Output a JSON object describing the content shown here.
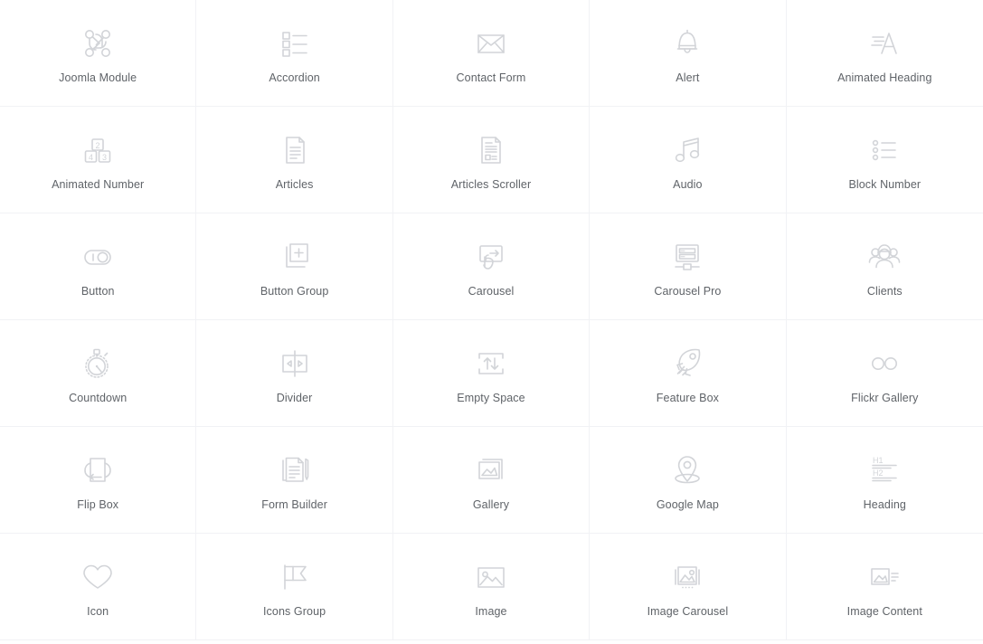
{
  "grid": {
    "columns": 5,
    "rows": 6,
    "accent_color": "#d2d4d8",
    "label_color": "#5f6368",
    "divider_color": "#f1f2f5",
    "background_color": "#ffffff"
  },
  "elements": [
    {
      "label": "Joomla Module",
      "icon": "joomla-module-icon"
    },
    {
      "label": "Accordion",
      "icon": "accordion-icon"
    },
    {
      "label": "Contact Form",
      "icon": "envelope-icon"
    },
    {
      "label": "Alert",
      "icon": "bell-icon"
    },
    {
      "label": "Animated Heading",
      "icon": "animated-heading-icon"
    },
    {
      "label": "Animated Number",
      "icon": "number-blocks-icon"
    },
    {
      "label": "Articles",
      "icon": "document-lines-icon"
    },
    {
      "label": "Articles Scroller",
      "icon": "document-columns-icon"
    },
    {
      "label": "Audio",
      "icon": "music-note-icon"
    },
    {
      "label": "Block Number",
      "icon": "bullet-list-icon"
    },
    {
      "label": "Button",
      "icon": "toggle-switch-icon"
    },
    {
      "label": "Button Group",
      "icon": "plus-square-stack-icon"
    },
    {
      "label": "Carousel",
      "icon": "swipe-hand-icon"
    },
    {
      "label": "Carousel Pro",
      "icon": "slider-panel-icon"
    },
    {
      "label": "Clients",
      "icon": "people-group-icon"
    },
    {
      "label": "Countdown",
      "icon": "stopwatch-icon"
    },
    {
      "label": "Divider",
      "icon": "split-arrows-icon"
    },
    {
      "label": "Empty Space",
      "icon": "up-down-arrows-icon"
    },
    {
      "label": "Feature Box",
      "icon": "rocket-icon"
    },
    {
      "label": "Flickr Gallery",
      "icon": "two-circles-icon"
    },
    {
      "label": "Flip Box",
      "icon": "flip-card-icon"
    },
    {
      "label": "Form Builder",
      "icon": "document-pen-icon"
    },
    {
      "label": "Gallery",
      "icon": "photo-stack-icon"
    },
    {
      "label": "Google Map",
      "icon": "map-pin-icon"
    },
    {
      "label": "Heading",
      "icon": "heading-levels-icon"
    },
    {
      "label": "Icon",
      "icon": "heart-icon"
    },
    {
      "label": "Icons Group",
      "icon": "flag-icon"
    },
    {
      "label": "Image",
      "icon": "picture-icon"
    },
    {
      "label": "Image Carousel",
      "icon": "picture-carousel-icon"
    },
    {
      "label": "Image Content",
      "icon": "picture-text-icon"
    }
  ],
  "icon_glyph_text": {
    "heading_h1": "H1",
    "heading_h2": "H2",
    "number_top": "2",
    "number_left": "4",
    "number_right": "3",
    "plus": "+"
  }
}
